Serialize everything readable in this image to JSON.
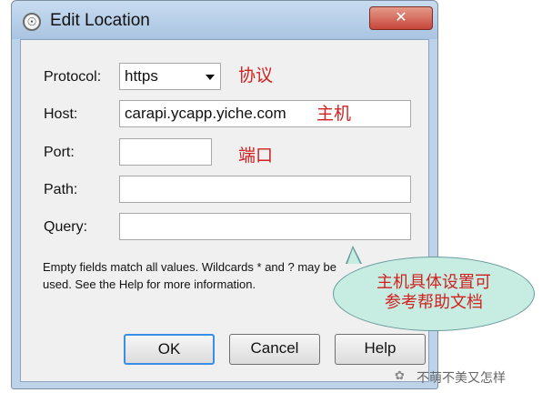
{
  "window": {
    "title": "Edit Location",
    "close_glyph": "✕"
  },
  "icons": {
    "app": "compass-app-icon",
    "close": "close-icon",
    "dropdown": "chevron-down-icon"
  },
  "form": {
    "protocol": {
      "label": "Protocol:",
      "value": "https"
    },
    "host": {
      "label": "Host:",
      "value": "carapi.ycapp.yiche.com"
    },
    "port": {
      "label": "Port:",
      "value": ""
    },
    "path": {
      "label": "Path:",
      "value": ""
    },
    "query": {
      "label": "Query:",
      "value": ""
    }
  },
  "annotations": {
    "protocol": "协议",
    "host": "主机",
    "port": "端口",
    "callout_line1": "主机具体设置可",
    "callout_line2": "参考帮助文档"
  },
  "help": {
    "line1": "Empty fields match all values. Wildcards * and ? may be",
    "line2": "used. See the Help for more information."
  },
  "buttons": {
    "ok": "OK",
    "cancel": "Cancel",
    "help": "Help"
  },
  "watermark": {
    "text": "不萌不美又怎样"
  },
  "colors": {
    "annotation_red": "#d02020",
    "callout_fill": "#c7ece1",
    "close_red": "#c6463a"
  }
}
